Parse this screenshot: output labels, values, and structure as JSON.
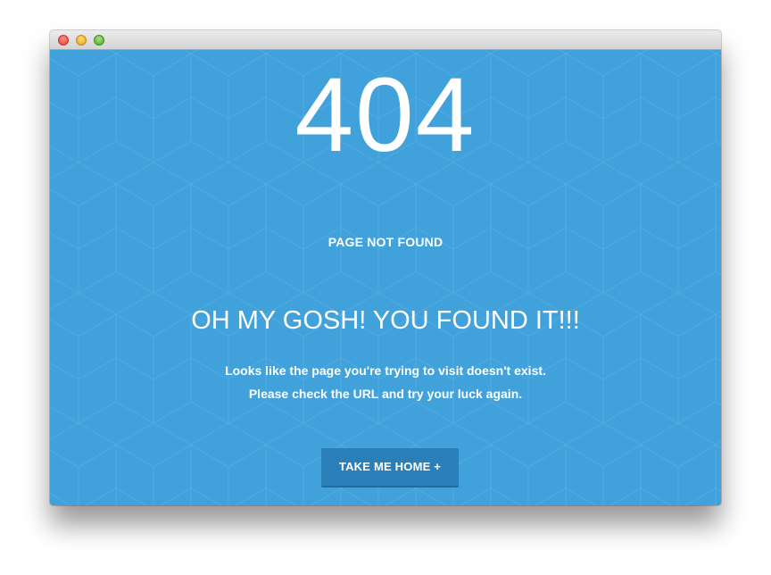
{
  "window": {
    "controls": [
      "close-light",
      "minimize-light",
      "maximize-light"
    ]
  },
  "error": {
    "code": "404",
    "subtitle": "PAGE NOT FOUND",
    "headline": "OH MY GOSH! YOU FOUND IT!!!",
    "message_line_1": "Looks like the page you're trying to visit doesn't exist.",
    "message_line_2": "Please check the URL and try your luck again."
  },
  "actions": {
    "home_button_label": "TAKE ME HOME +"
  },
  "colors": {
    "background": "#41a1db",
    "button": "#2a7fb8",
    "text": "#ffffff"
  }
}
